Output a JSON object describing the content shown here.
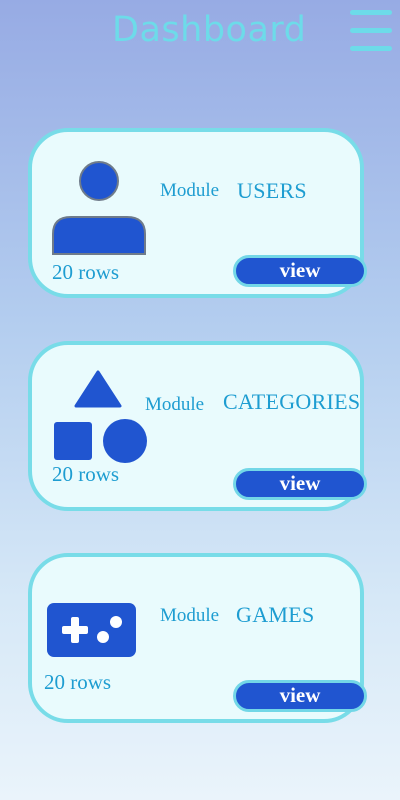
{
  "header": {
    "title": "Dashboard",
    "menu_icon": "hamburger-menu-icon"
  },
  "colors": {
    "accent": "#6ddbe9",
    "primary": "#2055d0",
    "text": "#1e9dd1",
    "card_bg": "#e9fbfd",
    "card_border": "#78dce8"
  },
  "modules": [
    {
      "label": "Module",
      "name": "USERS",
      "rows": "20 rows",
      "view_label": "view",
      "icon": "user-icon"
    },
    {
      "label": "Module",
      "name": "CATEGORIES",
      "rows": "20 rows",
      "view_label": "view",
      "icon": "shapes-icon"
    },
    {
      "label": "Module",
      "name": "GAMES",
      "rows": "20 rows",
      "view_label": "view",
      "icon": "gamepad-icon"
    }
  ]
}
